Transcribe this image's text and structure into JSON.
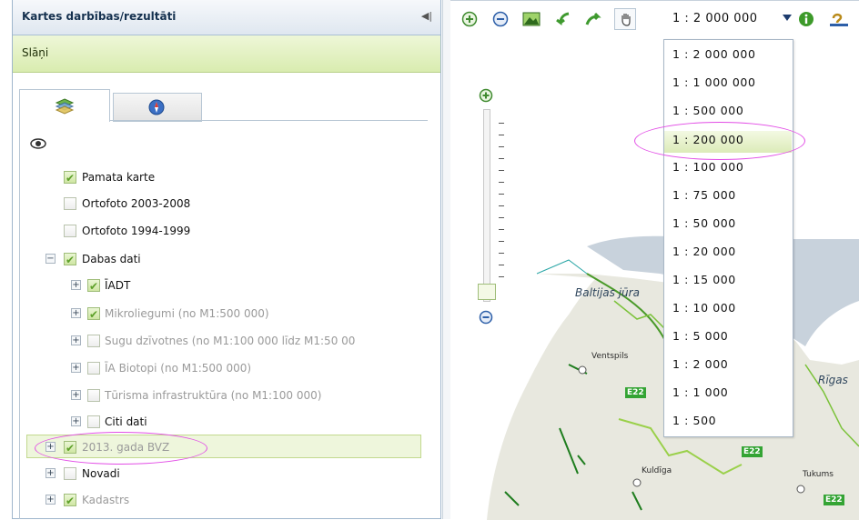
{
  "panel": {
    "title": "Kartes darbības/rezultāti",
    "layers_title": "Slāņi",
    "tabs": [
      "layers-icon",
      "compass-icon"
    ]
  },
  "tree": [
    {
      "label": "Pamata karte",
      "checked": true,
      "toggle": "",
      "style": "dark"
    },
    {
      "label": "Ortofoto 2003-2008",
      "checked": false,
      "toggle": "",
      "style": "dark"
    },
    {
      "label": "Ortofoto 1994-1999",
      "checked": false,
      "toggle": "",
      "style": "dark"
    },
    {
      "label": "Dabas dati",
      "checked": true,
      "toggle": "−",
      "style": "dark"
    },
    {
      "label": "ĪADT",
      "checked": true,
      "toggle": "+",
      "style": "dark"
    },
    {
      "label": "Mikroliegumi (no M1:500 000)",
      "checked": true,
      "toggle": "+",
      "style": "gray"
    },
    {
      "label": "Sugu dzīvotnes (no M1:100 000 līdz M1:50 00",
      "checked": false,
      "toggle": "+",
      "style": "gray"
    },
    {
      "label": "ĪA Biotopi (no M1:500 000)",
      "checked": false,
      "toggle": "+",
      "style": "gray"
    },
    {
      "label": "Tūrisma infrastruktūra (no M1:100 000)",
      "checked": false,
      "toggle": "+",
      "style": "gray"
    },
    {
      "label": "Citi dati",
      "checked": false,
      "toggle": "+",
      "style": "dark"
    },
    {
      "label": "2013. gada BVZ",
      "checked": true,
      "toggle": "+",
      "style": "gray"
    },
    {
      "label": "Novadi",
      "checked": false,
      "toggle": "+",
      "style": "dark"
    },
    {
      "label": "Kadastrs",
      "checked": true,
      "toggle": "+",
      "style": "gray"
    }
  ],
  "toolbar": {
    "tools": [
      "zoom-in-icon",
      "zoom-out-icon",
      "full-extent-icon",
      "back-arrow-icon",
      "forward-arrow-icon",
      "pan-hand-icon",
      "info-icon",
      "measure-icon"
    ],
    "scale_value": "1 : 2 000 000"
  },
  "scale_options": [
    "1 : 2 000 000",
    "1 : 1 000 000",
    "1 : 500 000",
    "1 : 200 000",
    "1 : 100 000",
    "1 : 75 000",
    "1 : 50 000",
    "1 : 20 000",
    "1 : 15 000",
    "1 : 10 000",
    "1 : 5 000",
    "1 : 2 000",
    "1 : 1 000",
    "1 : 500"
  ],
  "map": {
    "sea_label": "Baltijas jūra",
    "gulf_label": "Rīgas",
    "cities": [
      "Ventspils",
      "Kuldīga",
      "Tukums"
    ],
    "roads": [
      "E22",
      "E22",
      "E22"
    ]
  },
  "colors": {
    "accent_green": "#5ea02a",
    "highlight": "#e24de6",
    "sea": "#c5cfd9",
    "land": "#e9e9e2"
  }
}
